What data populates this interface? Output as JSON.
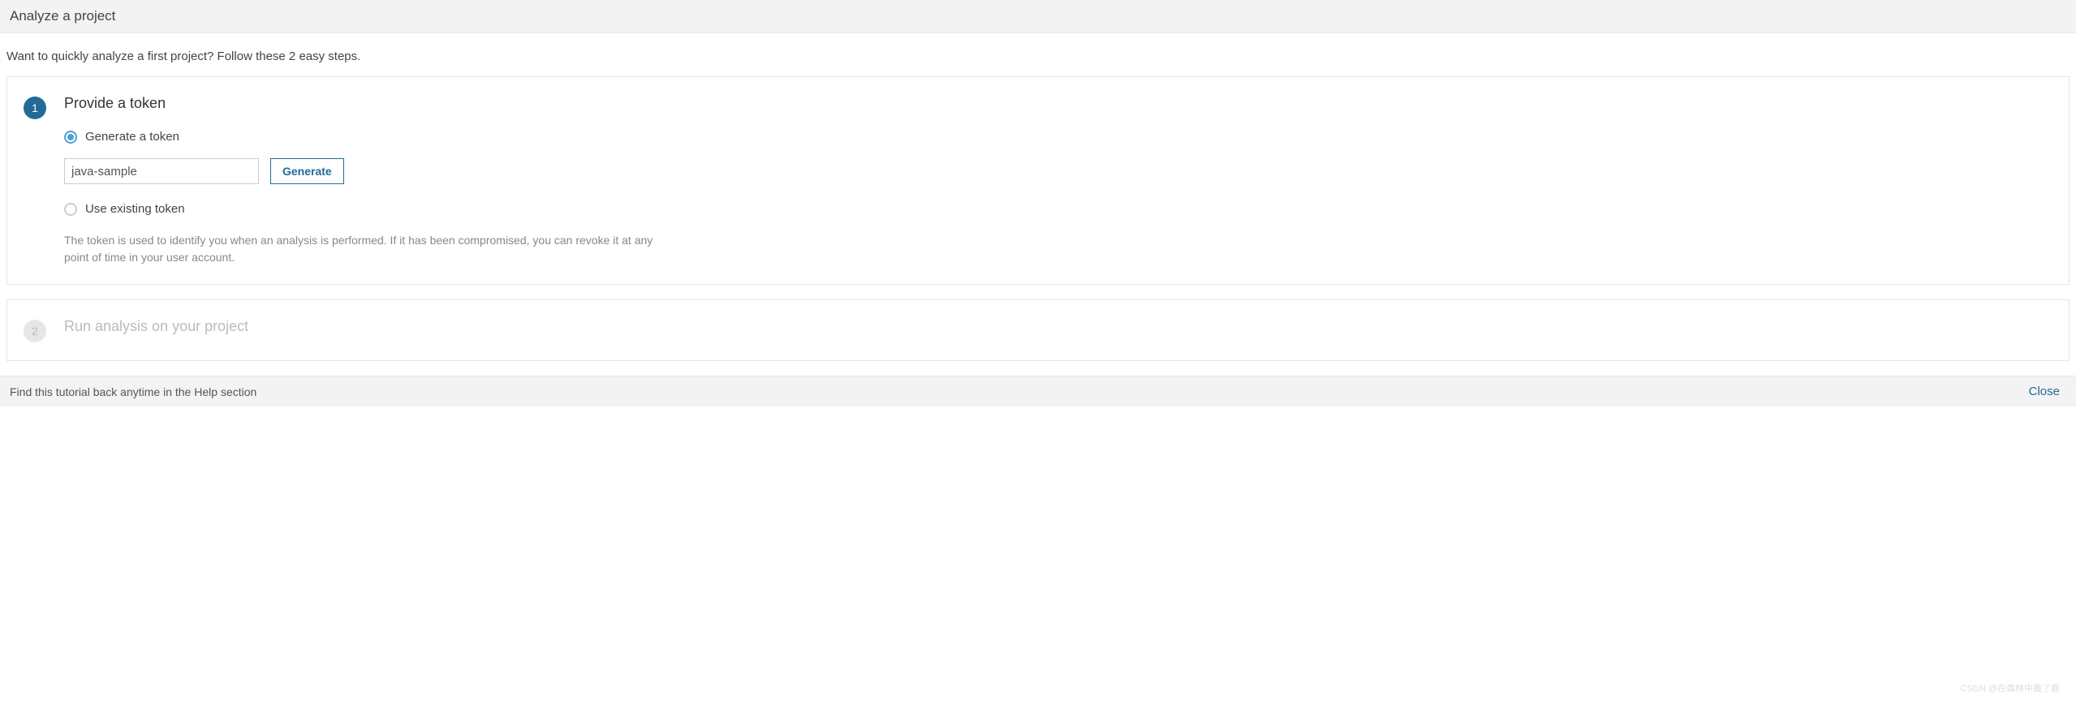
{
  "header": {
    "title": "Analyze a project"
  },
  "intro": "Want to quickly analyze a first project? Follow these 2 easy steps.",
  "step1": {
    "number": "1",
    "title": "Provide a token",
    "option_generate": "Generate a token",
    "option_existing": "Use existing token",
    "input_value": "java-sample",
    "generate_button": "Generate",
    "help_text": "The token is used to identify you when an analysis is performed. If it has been compromised, you can revoke it at any point of time in your user account."
  },
  "step2": {
    "number": "2",
    "title": "Run analysis on your project"
  },
  "footer": {
    "text": "Find this tutorial back anytime in the Help section",
    "close": "Close"
  },
  "watermark": "CSDN @在森林中麋了鹿"
}
